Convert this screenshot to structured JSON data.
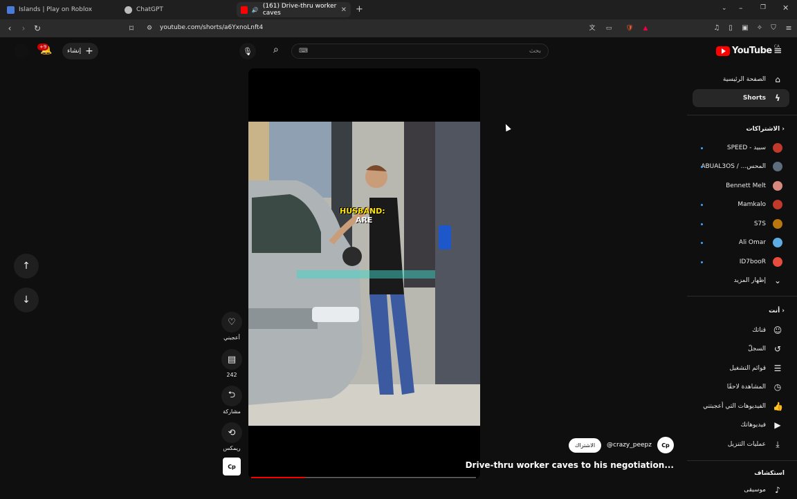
{
  "browser": {
    "tabs": [
      {
        "title": "Islands | Play on Roblox"
      },
      {
        "title": "ChatGPT"
      },
      {
        "title": "(161) Drive-thru worker caves"
      }
    ],
    "url": "youtube.com/shorts/a6YxnoLnft4"
  },
  "header": {
    "logo_text": "YouTube",
    "logo_region": "CA",
    "search_placeholder": "بحث",
    "create_label": "إنشاء",
    "notifications_count": "+9"
  },
  "sidebar": {
    "home": "الصفحة الرئيسية",
    "shorts": "Shorts",
    "subscriptions_title": "الاشتراكات",
    "subscriptions": [
      {
        "name": "SPEED - سبيد",
        "color": "#c0392b"
      },
      {
        "name": "ABUAL3OS / ...المحس",
        "color": "#5d6d7e"
      },
      {
        "name": "Bennett Melt",
        "color": "#d98880"
      },
      {
        "name": "Mamkalo",
        "color": "#c0392b"
      },
      {
        "name": "S7S",
        "color": "#b9770e"
      },
      {
        "name": "Ali Omar",
        "color": "#5dade2"
      },
      {
        "name": "ID7booR",
        "color": "#e74c3c"
      }
    ],
    "show_more": "إظهار المزيد",
    "you_title": "أنت",
    "you_items": [
      "قناتك",
      "السجلّ",
      "قوائم التشغيل",
      "المشاهدة لاحقًا",
      "الفيديوهات التي أعجبتني",
      "فيديوهاتك",
      "عمليات التنزيل"
    ],
    "explore_title": "استكشاف",
    "explore_items": [
      "موسيقى"
    ]
  },
  "short": {
    "caption_top": "HUSBAND:",
    "caption_bottom": "ARE",
    "title": "Drive-thru worker caves to his negotiation...",
    "channel": "@crazy_peepz",
    "channel_avatar_text": "Cp",
    "subscribe_label": "الاشتراك",
    "progress": 0.24,
    "actions": {
      "like": "أعجبني",
      "comments": "242",
      "share": "مشاركة",
      "remix": "ريمكس"
    }
  },
  "colors": {
    "accent": "#ff0000",
    "background": "#0f0f0f",
    "link_dot": "#3ea6ff"
  }
}
